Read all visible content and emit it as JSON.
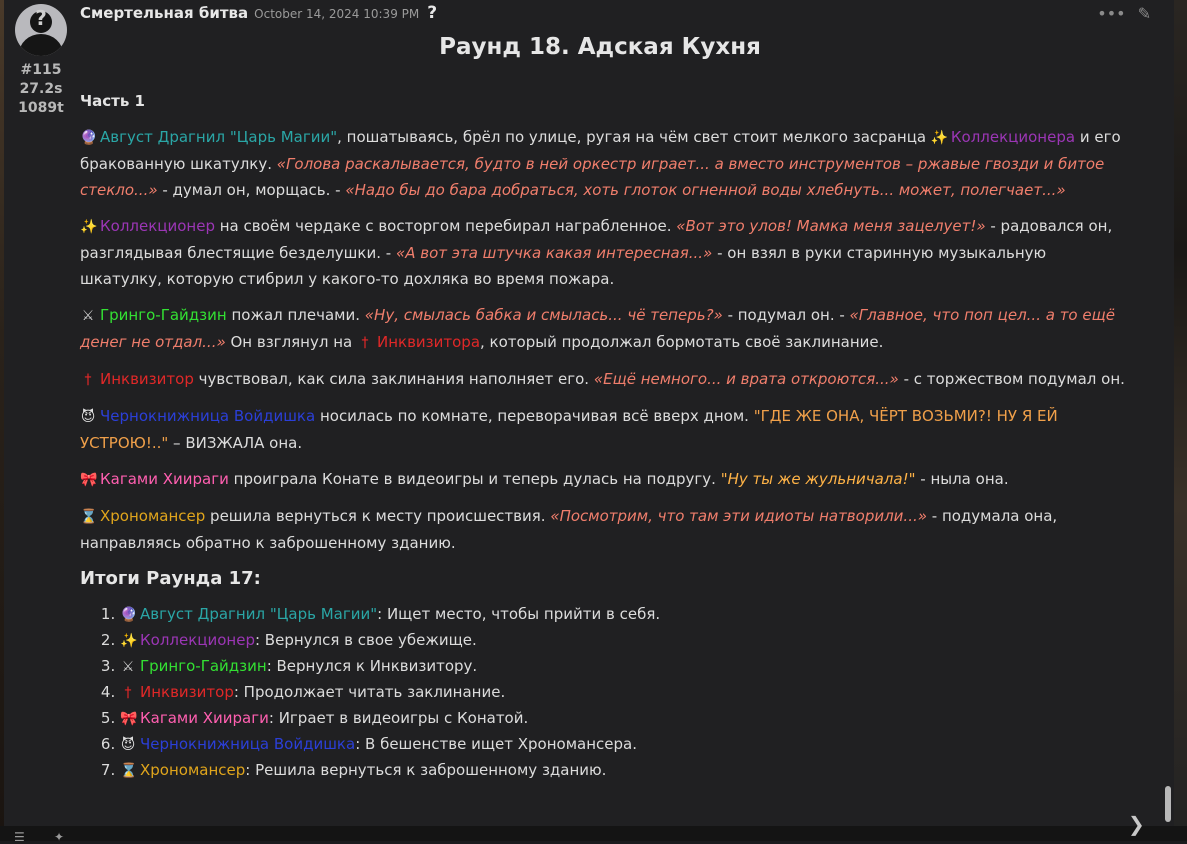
{
  "message": {
    "author": "Смертельная битва",
    "timestamp": "October 14, 2024 10:39 PM",
    "help_glyph": "?",
    "meta": {
      "index": "#115",
      "duration": "27.2s",
      "tokens": "1089t"
    },
    "tools": {
      "more_glyph": "•••",
      "edit_glyph": "✎"
    },
    "title": "Раунд 18. Адская Кухня",
    "part_heading": "Часть 1",
    "paragraphs": {
      "p1": {
        "emoji": "🔮",
        "name1": "Август Драгнил \"Царь Магии\"",
        "t1": ", пошатываясь, брёл по улице, ругая на чём свет стоит мелкого засранца ",
        "emoji2": "✨",
        "name2": "Коллекционера",
        "t2": " и его бракованную шкатулку. ",
        "q1": "«Голова раскалывается, будто в ней оркестр играет... а вместо инструментов – ржавые гвозди и битое стекло...»",
        "t3": " - думал он, морщась. - ",
        "q2": "«Надо бы до бара добраться, хоть глоток огненной воды хлебнуть... может, полегчает...»"
      },
      "p2": {
        "emoji": "✨",
        "name": "Коллекционер",
        "t1": " на своём чердаке с восторгом перебирал награбленное. ",
        "q1": "«Вот это улов! Мамка меня зацелует!»",
        "t2": " - радовался он, разглядывая блестящие безделушки. - ",
        "q2": "«А вот эта штучка какая интересная...»",
        "t3": " - он взял в руки старинную музыкальную шкатулку, которую стибрил у какого-то дохляка во время пожара."
      },
      "p3": {
        "emoji": "⚔",
        "name": "Гринго-Гайдзин",
        "t1": " пожал плечами. ",
        "q1": "«Ну, смылась бабка и смылась... чё теперь?»",
        "t2": " - подумал он. - ",
        "q2": "«Главное, что поп цел... а то ещё денег не отдал...»",
        "t3": " Он взглянул на ",
        "emoji2": "†",
        "name2": "Инквизитора",
        "t4": ", который продолжал бормотать своё заклинание."
      },
      "p4": {
        "emoji": "†",
        "name": "Инквизитор",
        "t1": " чувствовал, как сила заклинания наполняет его. ",
        "q1": "«Ещё немного... и врата откроются...»",
        "t2": " - с торжеством подумал он."
      },
      "p5": {
        "emoji": "😈",
        "name": "Чернокнижница Войдишка",
        "t1": " носилась по комнате, переворачивая всё вверх дном. ",
        "q1": "\"ГДЕ ЖЕ ОНА, ЧЁРТ ВОЗЬМИ?! НУ Я ЕЙ УСТРОЮ!..\"",
        "t2": " – ВИЗЖАЛА она."
      },
      "p6": {
        "emoji": "🎀",
        "name": "Кагами Хиираги",
        "t1": " проиграла Конате в видеоигры и теперь дулась на подругу. ",
        "q1": "\"Ну ты же жульничала!\"",
        "t2": " - ныла она."
      },
      "p7": {
        "emoji": "⌛",
        "name": "Хрономансер",
        "t1": " решила вернуться к месту происшествия. ",
        "q1": "«Посмотрим, что там эти идиоты натворили...»",
        "t2": " - подумала она, направляясь обратно к заброшенному зданию."
      }
    },
    "results_heading": "Итоги Раунда 17:",
    "results": [
      {
        "emoji": "🔮",
        "name": "Август Драгнил \"Царь Магии\"",
        "text": ": Ищет место, чтобы прийти в себя."
      },
      {
        "emoji": "✨",
        "name": "Коллекционер",
        "text": ": Вернулся в свое убежище."
      },
      {
        "emoji": "⚔",
        "name": "Гринго-Гайдзин",
        "text": ": Вернулся к Инквизитору."
      },
      {
        "emoji": "†",
        "name": "Инквизитор",
        "text": ": Продолжает читать заклинание."
      },
      {
        "emoji": "🎀",
        "name": "Кагами Хиираги",
        "text": ": Играет в видеоигры с Конатой."
      },
      {
        "emoji": "😈",
        "name": "Чернокнижница Войдишка",
        "text": ": В бешенстве ищет Хрономансера."
      },
      {
        "emoji": "⌛",
        "name": "Хрономансер",
        "text": ": Решила вернуться к заброшенному зданию."
      }
    ]
  },
  "colors": {
    "august": "#2aa6a6",
    "collector": "#9b36b5",
    "gringo": "#33e033",
    "inquisitor": "#e02828",
    "warlock": "#2b3fd8",
    "kagami": "#ff5fb0",
    "chrono": "#e0a51c",
    "quote": "#f07e6c"
  }
}
